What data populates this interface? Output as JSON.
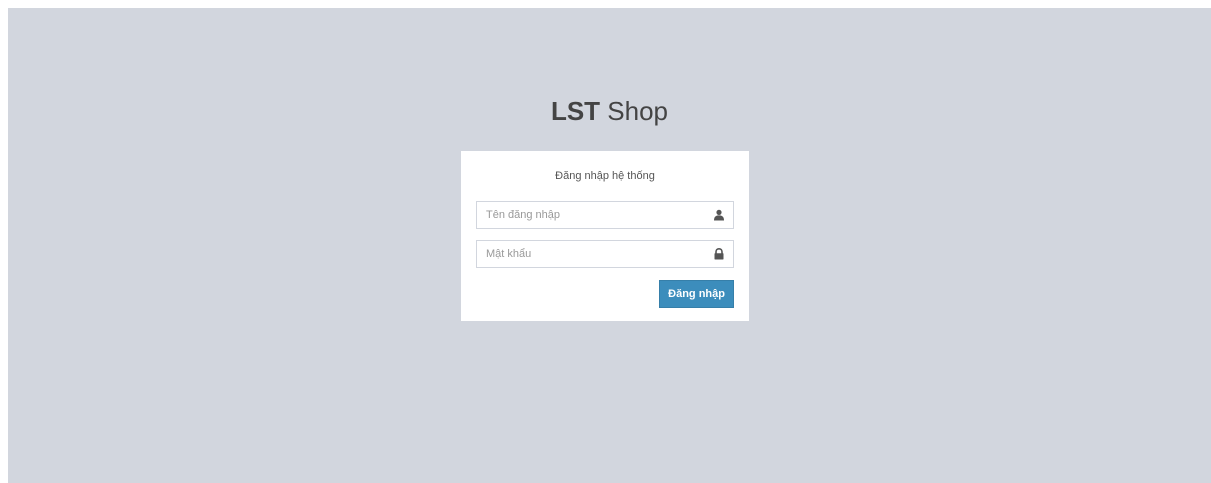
{
  "logo": {
    "bold": "LST",
    "light": "Shop"
  },
  "login": {
    "message": "Đăng nhập hệ thống",
    "username_placeholder": "Tên đăng nhập",
    "username_icon": "user-icon",
    "password_placeholder": "Mật khẩu",
    "password_icon": "lock-icon",
    "submit_label": "Đăng nhập"
  },
  "colors": {
    "background": "#d2d6de",
    "button": "#3c8dbc"
  }
}
